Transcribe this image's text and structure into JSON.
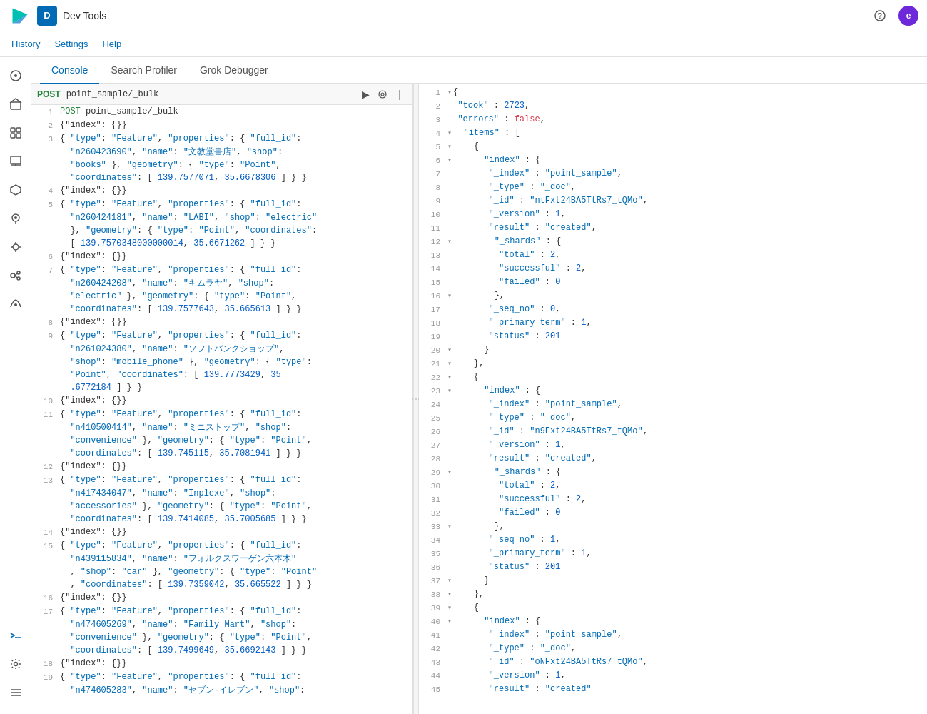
{
  "app": {
    "title": "Dev Tools",
    "badge": "D",
    "user_initial": "e"
  },
  "secondary_nav": {
    "links": [
      "History",
      "Settings",
      "Help"
    ]
  },
  "tabs": [
    {
      "label": "Console",
      "active": true
    },
    {
      "label": "Search Profiler",
      "active": false
    },
    {
      "label": "Grok Debugger",
      "active": false
    }
  ],
  "left_editor": {
    "method": "POST",
    "path": "point_sample/_bulk",
    "lines": [
      {
        "num": "1",
        "content": "POST point_sample/_bulk",
        "type": "header"
      },
      {
        "num": "2",
        "content": "{\"index\": {}}"
      },
      {
        "num": "3",
        "content": "{ \"type\": \"Feature\", \"properties\": { \"full_id\":"
      },
      {
        "num": "",
        "content": "  \"n260423690\", \"name\": \"文教堂書店\", \"shop\":"
      },
      {
        "num": "",
        "content": "  \"books\" }, \"geometry\": { \"type\": \"Point\","
      },
      {
        "num": "",
        "content": "  \"coordinates\": [ 139.7577071, 35.6678306 ] } }"
      },
      {
        "num": "4",
        "content": "{\"index\": {}}"
      },
      {
        "num": "5",
        "content": "{ \"type\": \"Feature\", \"properties\": { \"full_id\":"
      },
      {
        "num": "",
        "content": "  \"n260424181\", \"name\": \"LABI\", \"shop\": \"electric\""
      },
      {
        "num": "",
        "content": "  }, \"geometry\": { \"type\": \"Point\", \"coordinates\":"
      },
      {
        "num": "",
        "content": "  [ 139.7570348000000014, 35.6671262 ] } }"
      },
      {
        "num": "6",
        "content": "{\"index\": {}}"
      },
      {
        "num": "7",
        "content": "{ \"type\": \"Feature\", \"properties\": { \"full_id\":"
      },
      {
        "num": "",
        "content": "  \"n260424208\", \"name\": \"キムラヤ\", \"shop\":"
      },
      {
        "num": "",
        "content": "  \"electric\" }, \"geometry\": { \"type\": \"Point\","
      },
      {
        "num": "",
        "content": "  \"coordinates\": [ 139.7577643, 35.665613 ] } }"
      },
      {
        "num": "8",
        "content": "{\"index\": {}}"
      },
      {
        "num": "9",
        "content": "{ \"type\": \"Feature\", \"properties\": { \"full_id\":"
      },
      {
        "num": "",
        "content": "  \"n261024380\", \"name\": \"ソフトバンクショップ\","
      },
      {
        "num": "",
        "content": "  \"shop\": \"mobile_phone\" }, \"geometry\": { \"type\":"
      },
      {
        "num": "",
        "content": "  \"Point\", \"coordinates\": [ 139.7773429, 35"
      },
      {
        "num": "",
        "content": "  .6772184 ] } }"
      },
      {
        "num": "10",
        "content": "{\"index\": {}}"
      },
      {
        "num": "11",
        "content": "{ \"type\": \"Feature\", \"properties\": { \"full_id\":"
      },
      {
        "num": "",
        "content": "  \"n410500414\", \"name\": \"ミニストップ\", \"shop\":"
      },
      {
        "num": "",
        "content": "  \"convenience\" }, \"geometry\": { \"type\": \"Point\","
      },
      {
        "num": "",
        "content": "  \"coordinates\": [ 139.745115, 35.7081941 ] } }"
      },
      {
        "num": "12",
        "content": "{\"index\": {}}"
      },
      {
        "num": "13",
        "content": "{ \"type\": \"Feature\", \"properties\": { \"full_id\":"
      },
      {
        "num": "",
        "content": "  \"n417434047\", \"name\": \"Inplexe\", \"shop\":"
      },
      {
        "num": "",
        "content": "  \"accessories\" }, \"geometry\": { \"type\": \"Point\","
      },
      {
        "num": "",
        "content": "  \"coordinates\": [ 139.7414085, 35.7005685 ] } }"
      },
      {
        "num": "14",
        "content": "{\"index\": {}}"
      },
      {
        "num": "15",
        "content": "{ \"type\": \"Feature\", \"properties\": { \"full_id\":"
      },
      {
        "num": "",
        "content": "  \"n439115834\", \"name\": \"フォルクスワーゲン六本木\""
      },
      {
        "num": "",
        "content": "  , \"shop\": \"car\" }, \"geometry\": { \"type\": \"Point\""
      },
      {
        "num": "",
        "content": "  , \"coordinates\": [ 139.7359042, 35.665522 ] } }"
      },
      {
        "num": "16",
        "content": "{\"index\": {}}"
      },
      {
        "num": "17",
        "content": "{ \"type\": \"Feature\", \"properties\": { \"full_id\":"
      },
      {
        "num": "",
        "content": "  \"n474605269\", \"name\": \"Family Mart\", \"shop\":"
      },
      {
        "num": "",
        "content": "  \"convenience\" }, \"geometry\": { \"type\": \"Point\","
      },
      {
        "num": "",
        "content": "  \"coordinates\": [ 139.7499649, 35.6692143 ] } }"
      },
      {
        "num": "18",
        "content": "{\"index\": {}}"
      },
      {
        "num": "19",
        "content": "{ \"type\": \"Feature\", \"properties\": { \"full_id\":"
      },
      {
        "num": "",
        "content": "  \"n474605283\", \"name\": \"セブン-イレブン\", \"shop\":"
      }
    ]
  },
  "right_editor": {
    "lines": [
      {
        "num": "1",
        "content": "{",
        "collapse": true
      },
      {
        "num": "2",
        "content": "  \"took\" : 2723,"
      },
      {
        "num": "3",
        "content": "  \"errors\" : false,"
      },
      {
        "num": "4",
        "content": "  \"items\" : [",
        "collapse": true
      },
      {
        "num": "5",
        "content": "    {",
        "collapse": true
      },
      {
        "num": "6",
        "content": "      \"index\" : {",
        "collapse": true
      },
      {
        "num": "7",
        "content": "        \"_index\" : \"point_sample\","
      },
      {
        "num": "8",
        "content": "        \"_type\" : \"_doc\","
      },
      {
        "num": "9",
        "content": "        \"_id\" : \"ntFxt24BA5TtRs7_tQMo\","
      },
      {
        "num": "10",
        "content": "        \"_version\" : 1,"
      },
      {
        "num": "11",
        "content": "        \"result\" : \"created\","
      },
      {
        "num": "12",
        "content": "        \"_shards\" : {",
        "collapse": true
      },
      {
        "num": "13",
        "content": "          \"total\" : 2,"
      },
      {
        "num": "14",
        "content": "          \"successful\" : 2,"
      },
      {
        "num": "15",
        "content": "          \"failed\" : 0"
      },
      {
        "num": "16",
        "content": "        },",
        "collapse": true
      },
      {
        "num": "17",
        "content": "        \"_seq_no\" : 0,"
      },
      {
        "num": "18",
        "content": "        \"_primary_term\" : 1,"
      },
      {
        "num": "19",
        "content": "        \"status\" : 201"
      },
      {
        "num": "20",
        "content": "      }",
        "collapse": true
      },
      {
        "num": "21",
        "content": "    },",
        "collapse": true
      },
      {
        "num": "22",
        "content": "    {",
        "collapse": true
      },
      {
        "num": "23",
        "content": "      \"index\" : {",
        "collapse": true
      },
      {
        "num": "24",
        "content": "        \"_index\" : \"point_sample\","
      },
      {
        "num": "25",
        "content": "        \"_type\" : \"_doc\","
      },
      {
        "num": "26",
        "content": "        \"_id\" : \"n9Fxt24BA5TtRs7_tQMo\","
      },
      {
        "num": "27",
        "content": "        \"_version\" : 1,"
      },
      {
        "num": "28",
        "content": "        \"result\" : \"created\","
      },
      {
        "num": "29",
        "content": "        \"_shards\" : {",
        "collapse": true
      },
      {
        "num": "30",
        "content": "          \"total\" : 2,"
      },
      {
        "num": "31",
        "content": "          \"successful\" : 2,"
      },
      {
        "num": "32",
        "content": "          \"failed\" : 0"
      },
      {
        "num": "33",
        "content": "        },",
        "collapse": true
      },
      {
        "num": "34",
        "content": "        \"_seq_no\" : 1,"
      },
      {
        "num": "35",
        "content": "        \"_primary_term\" : 1,"
      },
      {
        "num": "36",
        "content": "        \"status\" : 201"
      },
      {
        "num": "37",
        "content": "      }",
        "collapse": true
      },
      {
        "num": "38",
        "content": "    },",
        "collapse": true
      },
      {
        "num": "39",
        "content": "    {",
        "collapse": true
      },
      {
        "num": "40",
        "content": "      \"index\" : {",
        "collapse": true
      },
      {
        "num": "41",
        "content": "        \"_index\" : \"point_sample\","
      },
      {
        "num": "42",
        "content": "        \"_type\" : \"_doc\","
      },
      {
        "num": "43",
        "content": "        \"_id\" : \"oNFxt24BA5TtRs7_tQMo\","
      },
      {
        "num": "44",
        "content": "        \"_version\" : 1,"
      },
      {
        "num": "45",
        "content": "        \"result\" : \"created\""
      }
    ]
  },
  "sidebar_icons": [
    {
      "name": "home-icon",
      "symbol": "⌂"
    },
    {
      "name": "discover-icon",
      "symbol": "◎"
    },
    {
      "name": "visualize-icon",
      "symbol": "⊞"
    },
    {
      "name": "dashboard-icon",
      "symbol": "▦"
    },
    {
      "name": "canvas-icon",
      "symbol": "⬡"
    },
    {
      "name": "maps-icon",
      "symbol": "⊙"
    },
    {
      "name": "ml-icon",
      "symbol": "◈"
    },
    {
      "name": "graph-icon",
      "symbol": "◑"
    },
    {
      "name": "observability-icon",
      "symbol": "♡"
    },
    {
      "name": "security-icon",
      "symbol": "⚙"
    }
  ]
}
